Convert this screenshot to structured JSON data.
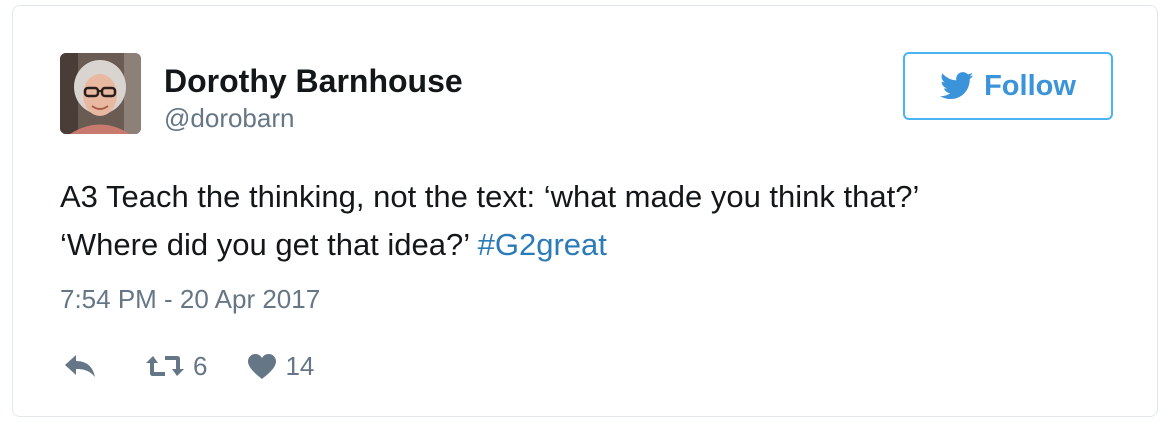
{
  "author": {
    "name": "Dorothy Barnhouse",
    "handle": "@dorobarn",
    "avatar_icon": "profile-photo"
  },
  "follow_button": {
    "label": "Follow",
    "icon": "twitter-bird-icon",
    "color": "#3b94d9",
    "border_color": "#4ab3f4"
  },
  "tweet": {
    "line1": "A3 Teach the thinking, not the text: ‘what made you think that?’",
    "line2_text": "‘Where did you get that idea?’ ",
    "hashtag": "#G2great",
    "timestamp": "7:54 PM - 20 Apr 2017"
  },
  "actions": {
    "reply_icon": "reply-icon",
    "retweet_icon": "retweet-icon",
    "retweet_count": "6",
    "like_icon": "heart-icon",
    "like_count": "14"
  },
  "colors": {
    "text": "#14171a",
    "secondary": "#657786",
    "hashtag": "#2b7bb9",
    "border": "#e1e8ed"
  }
}
